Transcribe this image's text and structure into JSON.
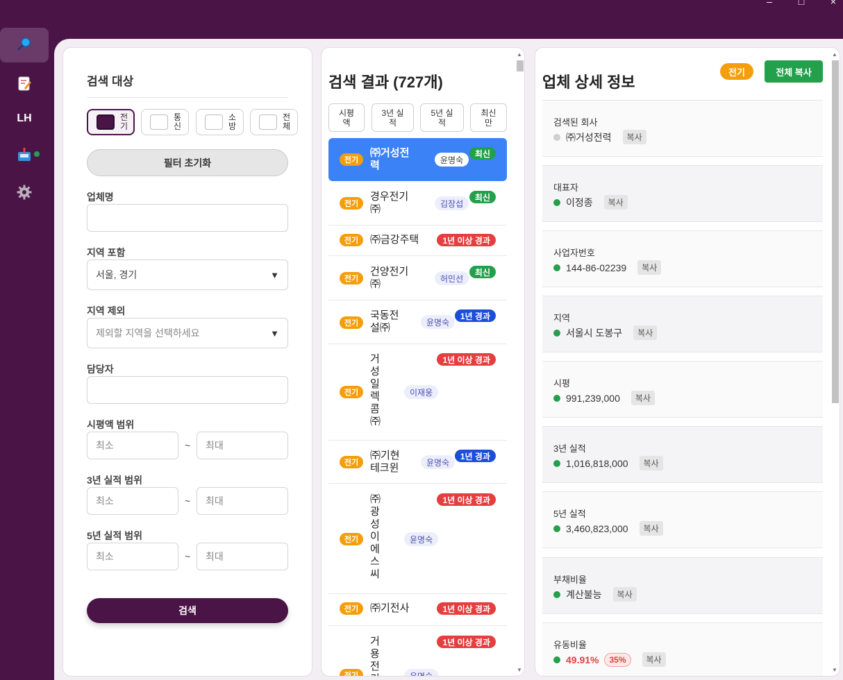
{
  "window": {
    "controls": [
      "–",
      "□",
      "×"
    ]
  },
  "sidebar": {
    "items": [
      {
        "name": "search",
        "icon": "search-icon"
      },
      {
        "name": "edit",
        "icon": "edit-document-icon"
      },
      {
        "name": "lh",
        "label": "LH"
      },
      {
        "name": "inbox",
        "icon": "inbox-icon",
        "status": "online"
      },
      {
        "name": "settings",
        "icon": "gear-icon"
      }
    ]
  },
  "filter": {
    "title": "검색 대상",
    "categories": [
      {
        "label": "전기",
        "selected": true
      },
      {
        "label": "통신",
        "selected": false
      },
      {
        "label": "소방",
        "selected": false
      },
      {
        "label": "전체",
        "selected": false
      }
    ],
    "reset_label": "필터 초기화",
    "company_label": "업체명",
    "company_value": "",
    "region_include_label": "지역 포함",
    "region_include_value": "서울, 경기",
    "region_exclude_label": "지역 제외",
    "region_exclude_placeholder": "제외할 지역을 선택하세요",
    "manager_label": "담당자",
    "manager_value": "",
    "sipyeong_label": "시평액 범위",
    "perf3_label": "3년 실적 범위",
    "perf5_label": "5년 실적 범위",
    "min_placeholder": "최소",
    "max_placeholder": "최대",
    "tilde": "~",
    "search_label": "검색"
  },
  "results": {
    "title": "검색 결과 (727개)",
    "sort_buttons": [
      "시평액",
      "3년 실적",
      "5년 실적",
      "최신만"
    ],
    "items": [
      {
        "tag": "전기",
        "name": "㈜거성전력",
        "manager": "윤명숙",
        "status": "최신",
        "status_type": "green",
        "selected": true
      },
      {
        "tag": "전기",
        "name": "경우전기㈜",
        "manager": "김장섭",
        "status": "최신",
        "status_type": "green",
        "selected": false
      },
      {
        "tag": "전기",
        "name": "㈜금강주택",
        "manager": "",
        "status": "1년 이상 경과",
        "status_type": "red",
        "selected": false
      },
      {
        "tag": "전기",
        "name": "건양전기㈜",
        "manager": "허민선",
        "status": "최신",
        "status_type": "green",
        "selected": false
      },
      {
        "tag": "전기",
        "name": "국동전설㈜",
        "manager": "윤명숙",
        "status": "1년 경과",
        "status_type": "blue",
        "selected": false
      },
      {
        "tag": "전기",
        "name": "거성일렉콤㈜",
        "manager": "이재웅",
        "status": "1년 이상 경과",
        "status_type": "red",
        "selected": false
      },
      {
        "tag": "전기",
        "name": "㈜기현테크윈",
        "manager": "윤명숙",
        "status": "1년 경과",
        "status_type": "blue",
        "selected": false
      },
      {
        "tag": "전기",
        "name": "㈜광성이에스씨",
        "manager": "윤명숙",
        "status": "1년 이상 경과",
        "status_type": "red",
        "selected": false
      },
      {
        "tag": "전기",
        "name": "㈜기전사",
        "manager": "",
        "status": "1년 이상 경과",
        "status_type": "red",
        "selected": false
      },
      {
        "tag": "전기",
        "name": "거용전기",
        "manager": "윤명숙",
        "status": "1년 이상 경과",
        "status_type": "red",
        "selected": false
      }
    ]
  },
  "detail": {
    "title": "업체 상세 정보",
    "badge": "전기",
    "copy_all_label": "전체 복사",
    "copy_label": "복사",
    "fields": [
      {
        "label": "검색된 회사",
        "value": "㈜거성전력",
        "dot": "gray"
      },
      {
        "label": "대표자",
        "value": "이정종",
        "dot": "green"
      },
      {
        "label": "사업자번호",
        "value": "144-86-02239",
        "dot": "green"
      },
      {
        "label": "지역",
        "value": "서울시 도봉구",
        "dot": "green"
      },
      {
        "label": "시평",
        "value": "991,239,000",
        "dot": "green"
      },
      {
        "label": "3년 실적",
        "value": "1,016,818,000",
        "dot": "green"
      },
      {
        "label": "5년 실적",
        "value": "3,460,823,000",
        "dot": "green"
      },
      {
        "label": "부채비율",
        "value": "계산불능",
        "dot": "green"
      },
      {
        "label": "유동비율",
        "value": "49.91%",
        "dot": "green",
        "extra": "35%",
        "value_style": "red"
      }
    ]
  },
  "colors": {
    "brand": "#4a1447",
    "selected_row": "#3b82f6",
    "tag_orange": "#f59e0b",
    "status_green": "#22a04b",
    "status_red": "#e53e3e",
    "status_blue": "#1d4ed8"
  }
}
